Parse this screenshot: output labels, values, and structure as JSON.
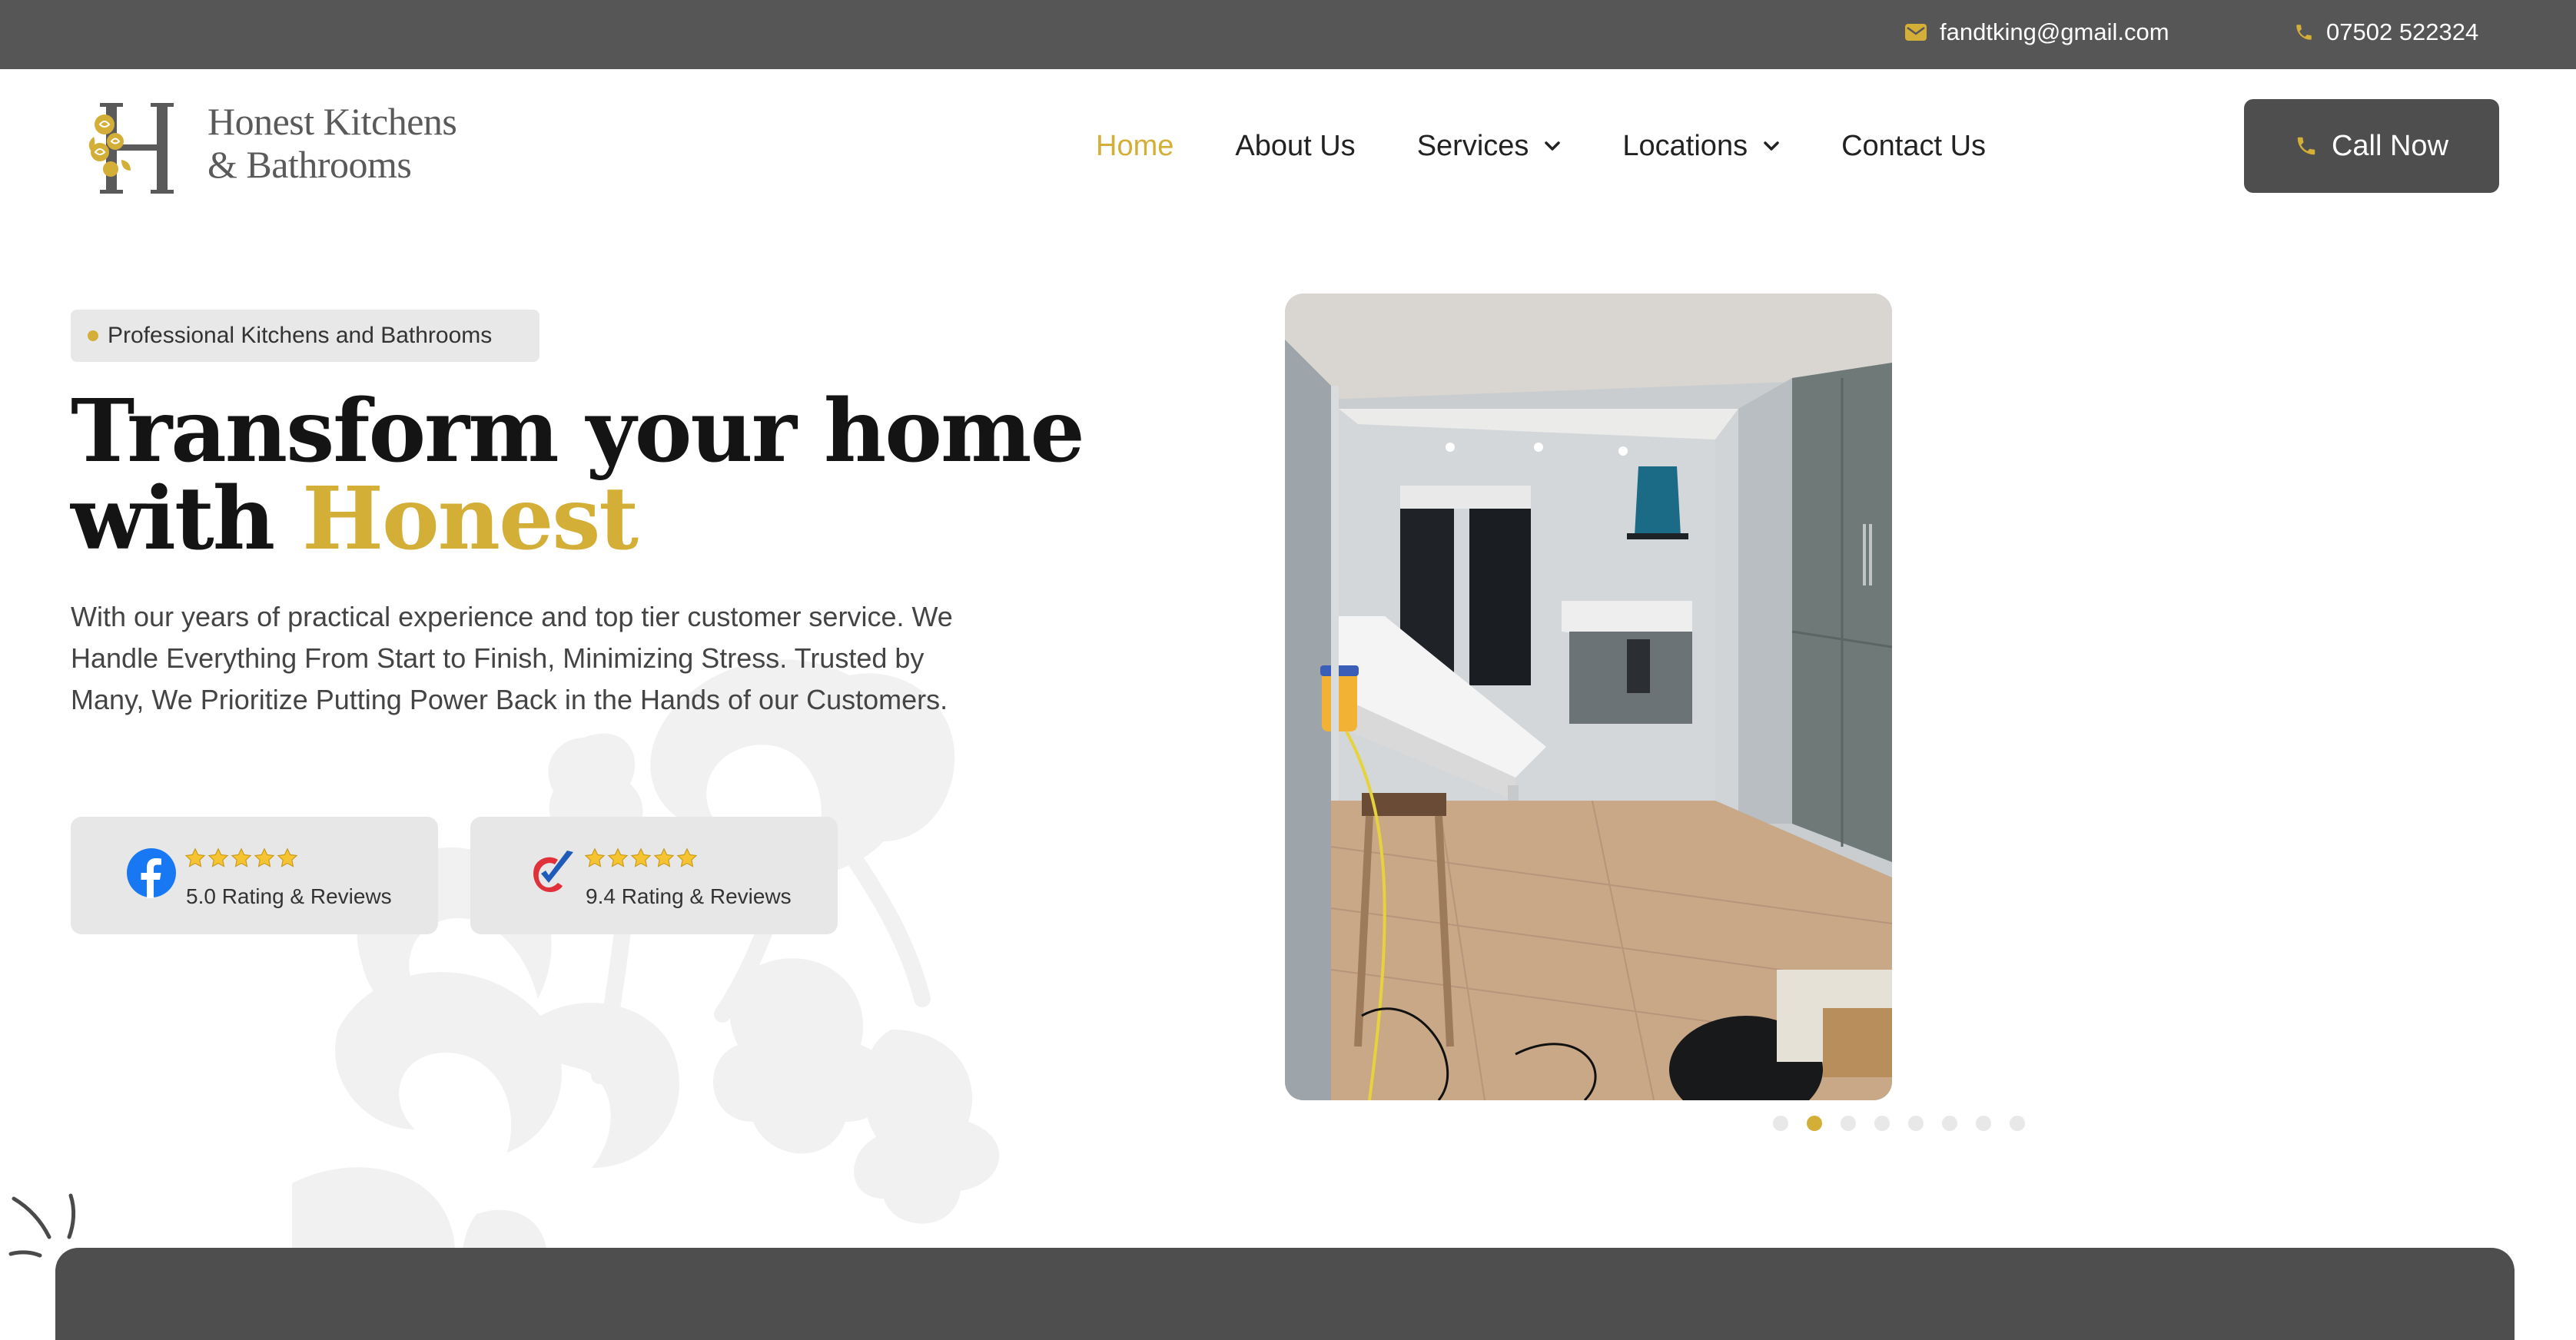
{
  "topbar": {
    "email": "fandtking@gmail.com",
    "phone": "07502 522324",
    "email_icon": "mail-icon",
    "phone_icon": "phone-icon"
  },
  "brand": {
    "line1": "Honest Kitchens",
    "line2": "& Bathrooms",
    "monogram": "H",
    "accent_color": "#d4af37",
    "dark_color": "#4e4e4e"
  },
  "nav": {
    "items": [
      {
        "label": "Home",
        "active": true
      },
      {
        "label": "About Us",
        "active": false
      },
      {
        "label": "Services",
        "active": false,
        "dropdown": true
      },
      {
        "label": "Locations",
        "active": false,
        "dropdown": true
      },
      {
        "label": "Contact Us",
        "active": false
      }
    ],
    "cta": "Call Now"
  },
  "hero": {
    "badge": "Professional Kitchens and Bathrooms",
    "title_line1": "Transform your home",
    "title_line2_prefix": "with ",
    "title_line2_accent": "Honest",
    "description": "With our years of practical experience and top tier customer service. We Handle Everything From Start to Finish, Minimizing Stress. Trusted by Many, We Prioritize Putting Power Back in the Hands of our Customers.",
    "ratings": [
      {
        "source_icon": "facebook-icon",
        "stars": 5,
        "label": "5.0 Rating & Reviews"
      },
      {
        "source_icon": "checkatrade-icon",
        "stars": 5,
        "label": "9.4 Rating & Reviews"
      }
    ]
  },
  "carousel": {
    "slide_count": 8,
    "active_index": 1
  }
}
